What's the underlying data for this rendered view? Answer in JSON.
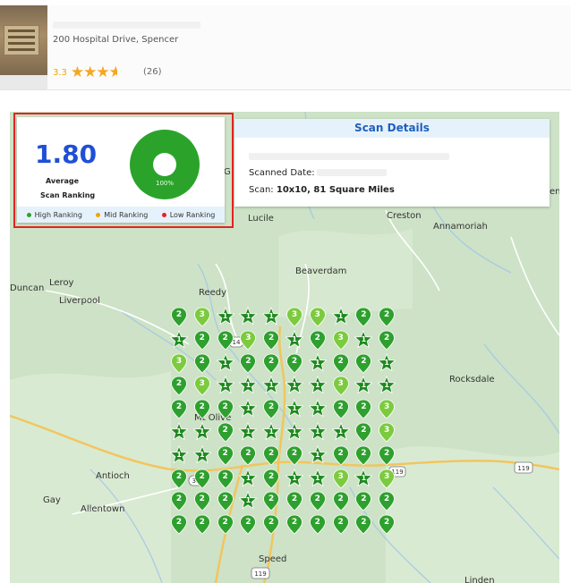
{
  "business": {
    "address": "200 Hospital Drive, Spencer",
    "rating": "3.3",
    "review_count": "(26)",
    "stars_filled": 3.3,
    "stars_shown": 4
  },
  "ranking": {
    "value": "1.80",
    "label_line1": "Average",
    "label_line2": "Scan Ranking",
    "donut_percent": "100%",
    "legend": [
      {
        "label": "High Ranking",
        "color": "#2ba32a"
      },
      {
        "label": "Mid Ranking",
        "color": "#f0a500"
      },
      {
        "label": "Low Ranking",
        "color": "#e32222"
      }
    ]
  },
  "scan": {
    "title": "Scan Details",
    "date_label": "Scanned Date:",
    "size_label": "Scan: ",
    "size_value": "10x10, 81 Square Miles"
  },
  "map": {
    "places": [
      {
        "name": "Lucile"
      },
      {
        "name": "Creston"
      },
      {
        "name": "Annamoriah"
      },
      {
        "name": "Beaverdam"
      },
      {
        "name": "Duncan"
      },
      {
        "name": "Leroy"
      },
      {
        "name": "Liverpool"
      },
      {
        "name": "Reedy"
      },
      {
        "name": "Rocksdale"
      },
      {
        "name": "Mt Olive"
      },
      {
        "name": "Antioch"
      },
      {
        "name": "Gay"
      },
      {
        "name": "Allentown"
      },
      {
        "name": "Speed"
      },
      {
        "name": "Linden"
      },
      {
        "name": "G"
      },
      {
        "name": "enc"
      }
    ],
    "road_labels": [
      "14",
      "33",
      "119",
      "119",
      "119"
    ]
  },
  "grid": {
    "rows": [
      [
        "2",
        "3",
        "1*",
        "1*",
        "1*",
        "3",
        "3",
        "1*",
        "2",
        "2"
      ],
      [
        "1*",
        "2",
        "2",
        "3",
        "2",
        "1*",
        "2",
        "3",
        "1*",
        "2"
      ],
      [
        "3",
        "2",
        "1*",
        "2",
        "2",
        "2",
        "1*",
        "2",
        "2",
        "1*"
      ],
      [
        "2",
        "3",
        "1*",
        "1*",
        "1*",
        "1*",
        "1*",
        "3",
        "1*",
        "1*"
      ],
      [
        "2",
        "2",
        "2",
        "1*",
        "2",
        "1*",
        "1*",
        "2",
        "2",
        "3"
      ],
      [
        "1*",
        "1*",
        "2",
        "1*",
        "1*",
        "1*",
        "1*",
        "1*",
        "2",
        "3"
      ],
      [
        "1*",
        "1*",
        "2",
        "2",
        "2",
        "2",
        "1*",
        "2",
        "2",
        "2"
      ],
      [
        "2",
        "2",
        "2",
        "1*",
        "2",
        "1*",
        "1*",
        "3",
        "1*",
        "3"
      ],
      [
        "2",
        "2",
        "2",
        "1*",
        "2",
        "2",
        "2",
        "2",
        "2",
        "2"
      ],
      [
        "2",
        "2",
        "2",
        "2",
        "2",
        "2",
        "2",
        "2",
        "2",
        "2"
      ]
    ],
    "colors": {
      "1": "#1e8a1e",
      "2": "#2ea02e",
      "3": "#7ccb3f"
    }
  }
}
